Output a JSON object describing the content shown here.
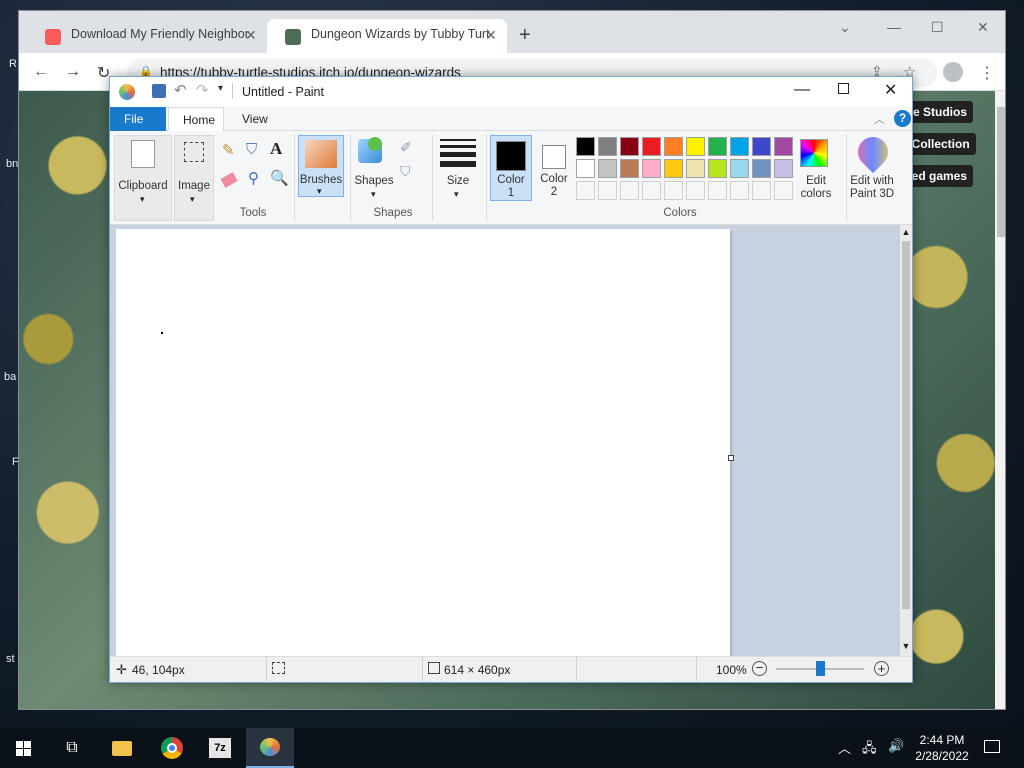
{
  "desktop": {
    "labels": [
      "R",
      "bn",
      "ba",
      "F",
      "st"
    ]
  },
  "browser": {
    "tabs": [
      {
        "title": "Download My Friendly Neighbor",
        "active": false
      },
      {
        "title": "Dungeon Wizards by Tubby Turt",
        "active": true
      }
    ],
    "url": "https://tubby-turtle-studios.itch.io/dungeon-wizards",
    "side_links": [
      "rtle Studios",
      "o Collection",
      "ated games"
    ]
  },
  "paint": {
    "title": "Untitled - Paint",
    "tabs": {
      "file": "File",
      "home": "Home",
      "view": "View"
    },
    "groups": {
      "clipboard": "Clipboard",
      "image": "Image",
      "tools": "Tools",
      "brushes": "Brushes",
      "shapes_btn": "Shapes",
      "shapes": "Shapes",
      "size": "Size",
      "color1": "Color\n1",
      "color2": "Color\n2",
      "colors": "Colors",
      "edit_colors": "Edit\ncolors",
      "paint3d": "Edit with\nPaint 3D"
    },
    "palette_row1": [
      "#000000",
      "#7f7f7f",
      "#880015",
      "#ed1c24",
      "#ff7f27",
      "#fff200",
      "#22b14c",
      "#00a2e8",
      "#3f48cc",
      "#a349a4"
    ],
    "palette_row2": [
      "#ffffff",
      "#c3c3c3",
      "#b97a57",
      "#ffaec9",
      "#ffc90e",
      "#efe4b0",
      "#b5e61d",
      "#99d9ea",
      "#7092be",
      "#c8bfe7"
    ],
    "color1": "#000000",
    "color2": "#ffffff",
    "status": {
      "cursor_pos": "46, 104px",
      "canvas_size": "614 × 460px",
      "zoom": "100%"
    }
  },
  "taskbar": {
    "time": "2:44 PM",
    "date": "2/28/2022"
  }
}
